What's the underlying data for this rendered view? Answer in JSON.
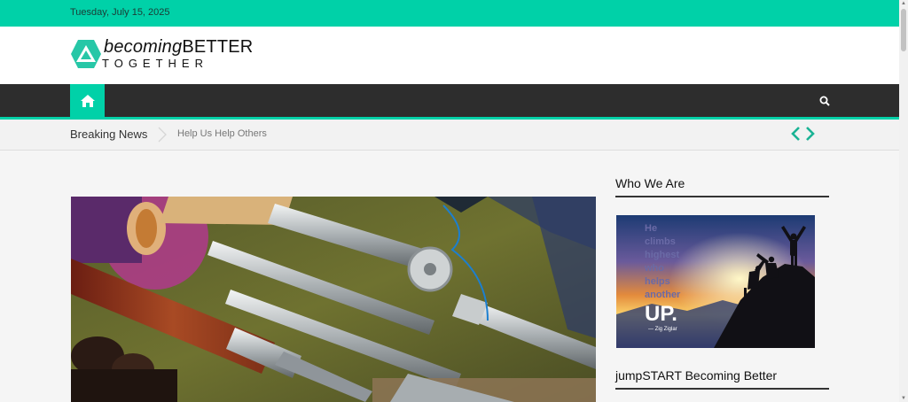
{
  "topbar": {
    "date": "Tuesday, July 15, 2025"
  },
  "logo": {
    "line1_italic": "becoming",
    "line1_caps": "BETTER",
    "line2": "TOGETHER"
  },
  "nav": {
    "home_icon": "home-icon",
    "search_icon": "search-icon"
  },
  "breaking": {
    "label": "Breaking News",
    "item": "Help Us Help Others"
  },
  "sidebar": {
    "widgets": [
      {
        "title": "Who We Are"
      },
      {
        "title": "jumpSTART Becoming Better"
      }
    ],
    "quote": {
      "lines": [
        "He",
        "climbs",
        "highest",
        "who",
        "helps",
        "another"
      ],
      "emphasis": "UP.",
      "author": "— Zig Ziglar"
    }
  },
  "colors": {
    "accent": "#00d1a8",
    "nav": "#2d2d2d"
  }
}
